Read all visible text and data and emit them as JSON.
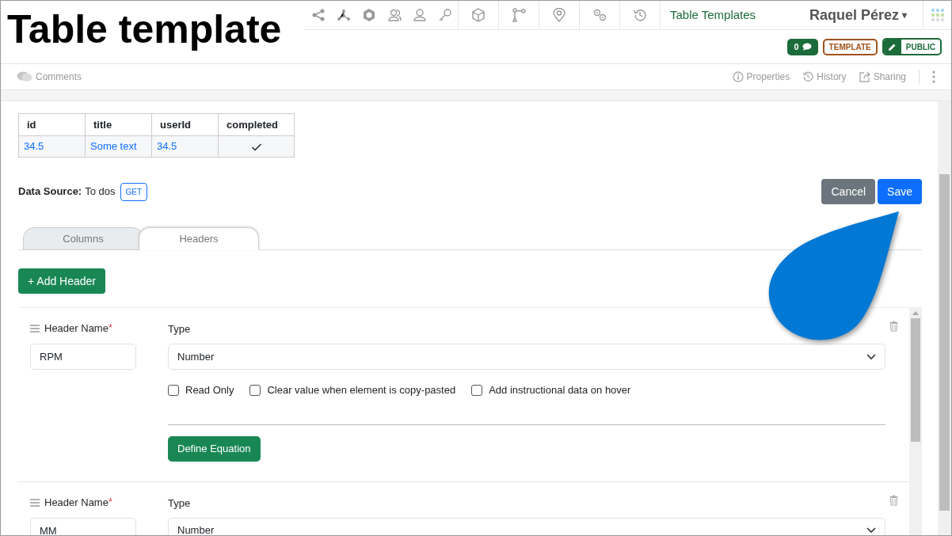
{
  "caption": "Table template",
  "nav": {
    "section": "Table Templates",
    "user": "Raquel Pérez",
    "caret": "▾"
  },
  "badges": {
    "comments": "0",
    "template": "TEMPLATE",
    "visibility": "PUBLIC"
  },
  "toolbar": {
    "comments": "Comments",
    "actions": [
      "Properties",
      "History",
      "Sharing"
    ]
  },
  "table": {
    "columns": [
      "id",
      "title",
      "userId",
      "completed"
    ],
    "rows": [
      {
        "cells": [
          "34.5",
          "Some text",
          "34.5"
        ],
        "completed": true
      }
    ]
  },
  "data_source": {
    "label": "Data Source:",
    "value": "To dos",
    "method": "GET"
  },
  "buttons": [
    "Cancel",
    "Save"
  ],
  "tabs": [
    {
      "label": "Columns",
      "selected": false
    },
    {
      "label": "Headers",
      "selected": true
    }
  ],
  "add_button": "+ Add Header",
  "headers": [
    {
      "name_label": "Header Name",
      "required": "*",
      "name": "RPM",
      "type_label": "Type",
      "type": "Number",
      "options": [
        {
          "label": "Read Only",
          "checked": false
        },
        {
          "label": "Clear value when element is copy-pasted",
          "checked": false
        },
        {
          "label": "Add instructional data on hover",
          "checked": false
        }
      ],
      "action": "Define Equation"
    },
    {
      "name_label": "Header Name",
      "required": "*",
      "name": "MM",
      "type_label": "Type",
      "type": "Number"
    }
  ]
}
